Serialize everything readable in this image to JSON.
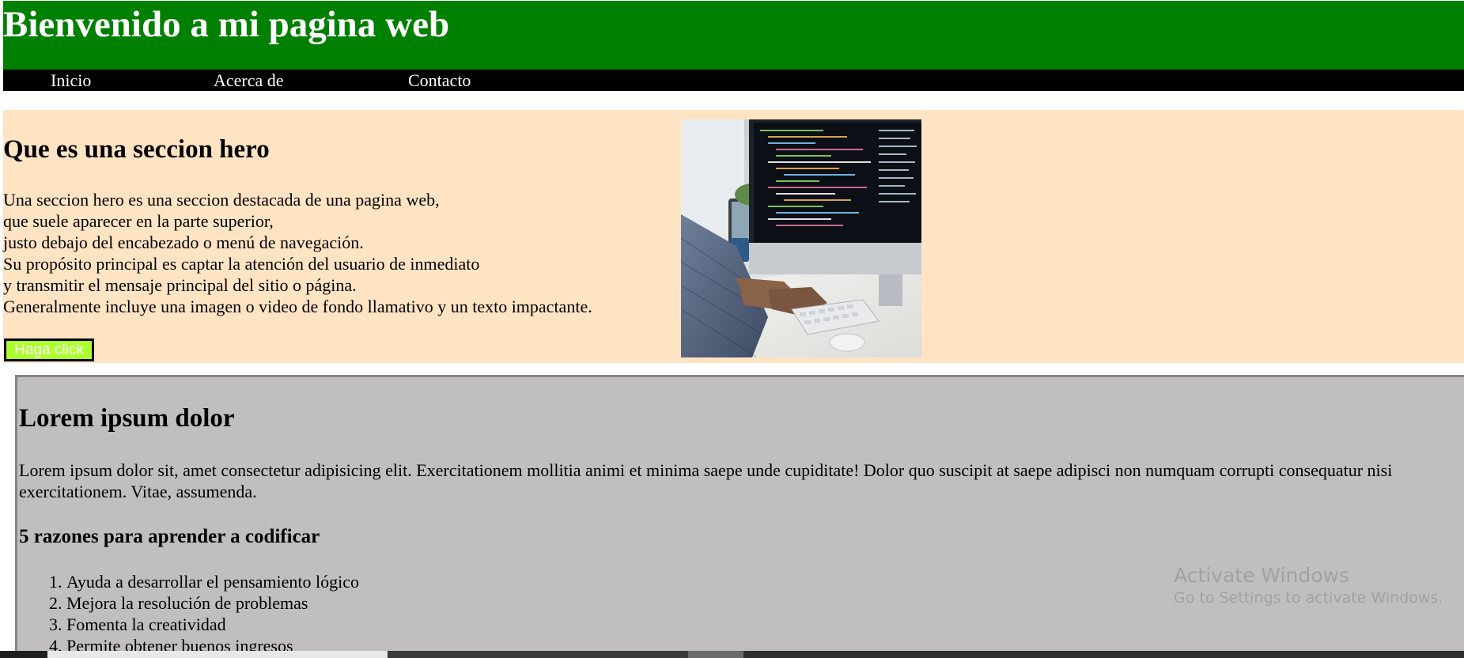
{
  "header": {
    "title": "Bienvenido a mi pagina web",
    "background_color": "#008000"
  },
  "nav": {
    "items": [
      {
        "label": "Inicio"
      },
      {
        "label": "Acerca de"
      },
      {
        "label": "Contacto"
      }
    ]
  },
  "hero": {
    "title": "Que es una seccion hero",
    "lines": [
      "Una seccion hero es una seccion destacada de una pagina web,",
      "que suele aparecer en la parte superior,",
      "justo debajo del encabezado o menú de navegación.",
      "Su propósito principal es captar la atención del usuario de inmediato",
      "y transmitir el mensaje principal del sitio o página.",
      "Generalmente incluye una imagen o video de fondo llamativo y un texto impactante."
    ],
    "button_label": "Haga click",
    "background_color": "#ffe4c4",
    "button_color": "#adff2f"
  },
  "content": {
    "title": "Lorem ipsum dolor",
    "paragraph": "Lorem ipsum dolor sit, amet consectetur adipisicing elit. Exercitationem mollitia animi et minima saepe unde cupiditate! Dolor quo suscipit at saepe adipisci non numquam corrupti consequatur nisi exercitationem. Vitae, assumenda.",
    "subtitle": "5 razones para aprender a codificar",
    "reasons": [
      "Ayuda a desarrollar el pensamiento lógico",
      "Mejora la resolución de problemas",
      "Fomenta la creatividad",
      "Permite obtener buenos ingresos"
    ],
    "background_color": "#c0bfbd"
  },
  "watermark": {
    "title": "Activate Windows",
    "subtitle": "Go to Settings to activate Windows."
  }
}
